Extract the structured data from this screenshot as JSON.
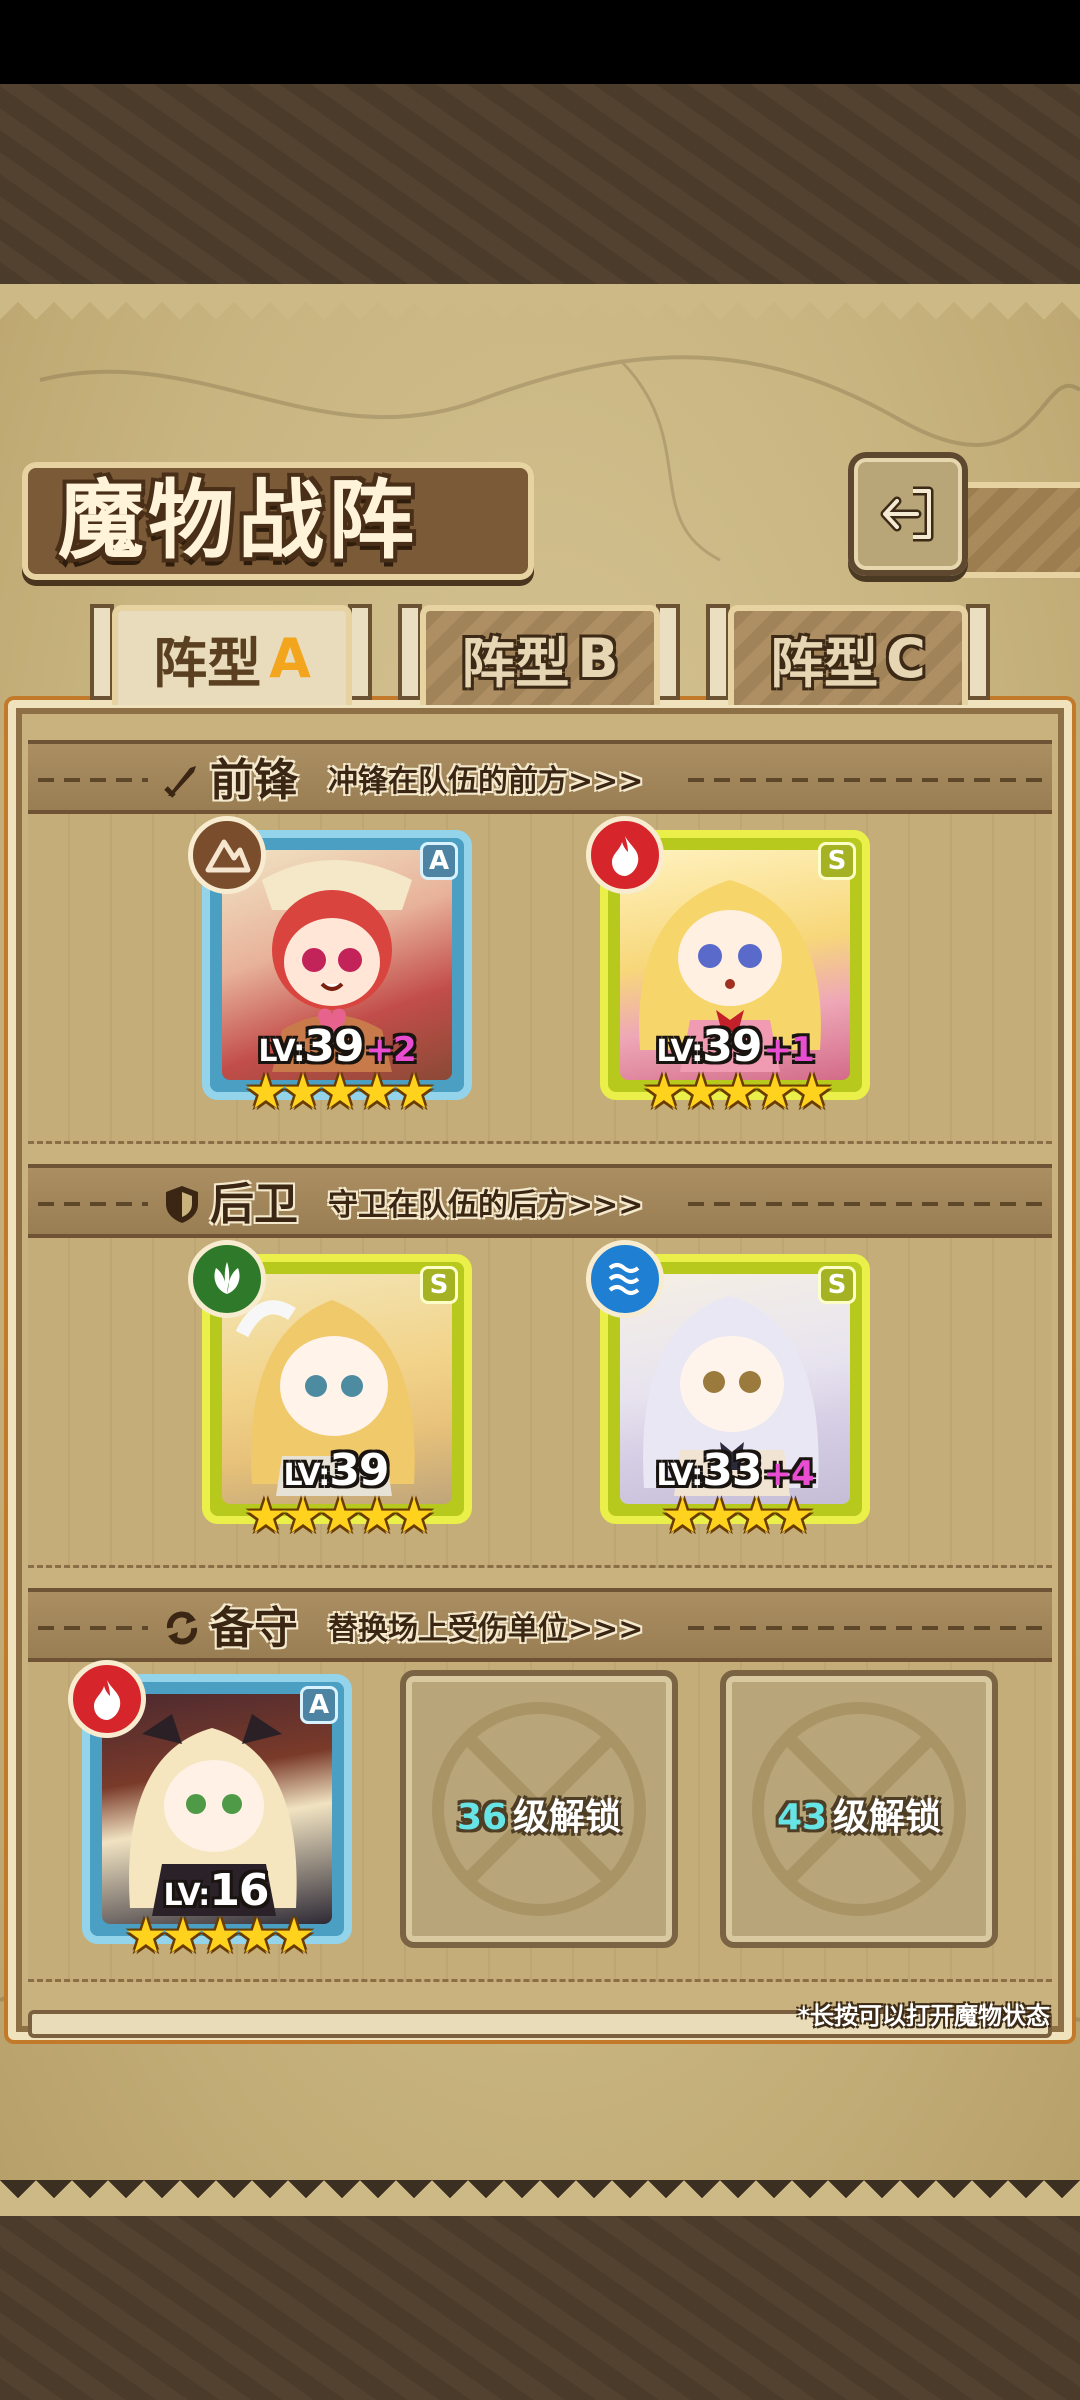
{
  "page": {
    "title": "魔物战阵",
    "back_icon": "back-arrow-icon"
  },
  "tabs": [
    {
      "prefix": "阵型",
      "letter": "A",
      "active": true
    },
    {
      "prefix": "阵型",
      "letter": "B",
      "active": false
    },
    {
      "prefix": "阵型",
      "letter": "C",
      "active": false
    }
  ],
  "sections": {
    "front": {
      "title": "前锋",
      "subtitle": "冲锋在队伍的前方>>>",
      "icon": "sword-icon"
    },
    "back": {
      "title": "后卫",
      "subtitle": "守卫在队伍的后方>>>",
      "icon": "shield-icon"
    },
    "reserve": {
      "title": "备守",
      "subtitle": "替换场上受伤单位>>>",
      "icon": "swap-icon"
    }
  },
  "monsters": {
    "front_1": {
      "rank": "A",
      "lv_prefix": "LV:",
      "level": "39",
      "plus": "+2",
      "stars": "★★★★★",
      "element": "earth",
      "element_color": "#7a4d2c"
    },
    "front_2": {
      "rank": "S",
      "lv_prefix": "LV:",
      "level": "39",
      "plus": "+1",
      "stars": "★★★★★",
      "element": "fire",
      "element_color": "#d7262b"
    },
    "back_1": {
      "rank": "S",
      "lv_prefix": "LV:",
      "level": "39",
      "plus": "",
      "stars": "★★★★★",
      "element": "wind",
      "element_color": "#2f7a2a"
    },
    "back_2": {
      "rank": "S",
      "lv_prefix": "LV:",
      "level": "33",
      "plus": "+4",
      "stars": "★★★★",
      "element": "water",
      "element_color": "#1f7fd3"
    },
    "reserve_1": {
      "rank": "A",
      "lv_prefix": "LV:",
      "level": "16",
      "plus": "",
      "stars": "★★★★★",
      "element": "fire",
      "element_color": "#d7262b"
    }
  },
  "locked_slots": [
    {
      "level": "36",
      "text": "级解锁"
    },
    {
      "level": "43",
      "text": "级解锁"
    }
  ],
  "footnote": "*长按可以打开魔物状态"
}
